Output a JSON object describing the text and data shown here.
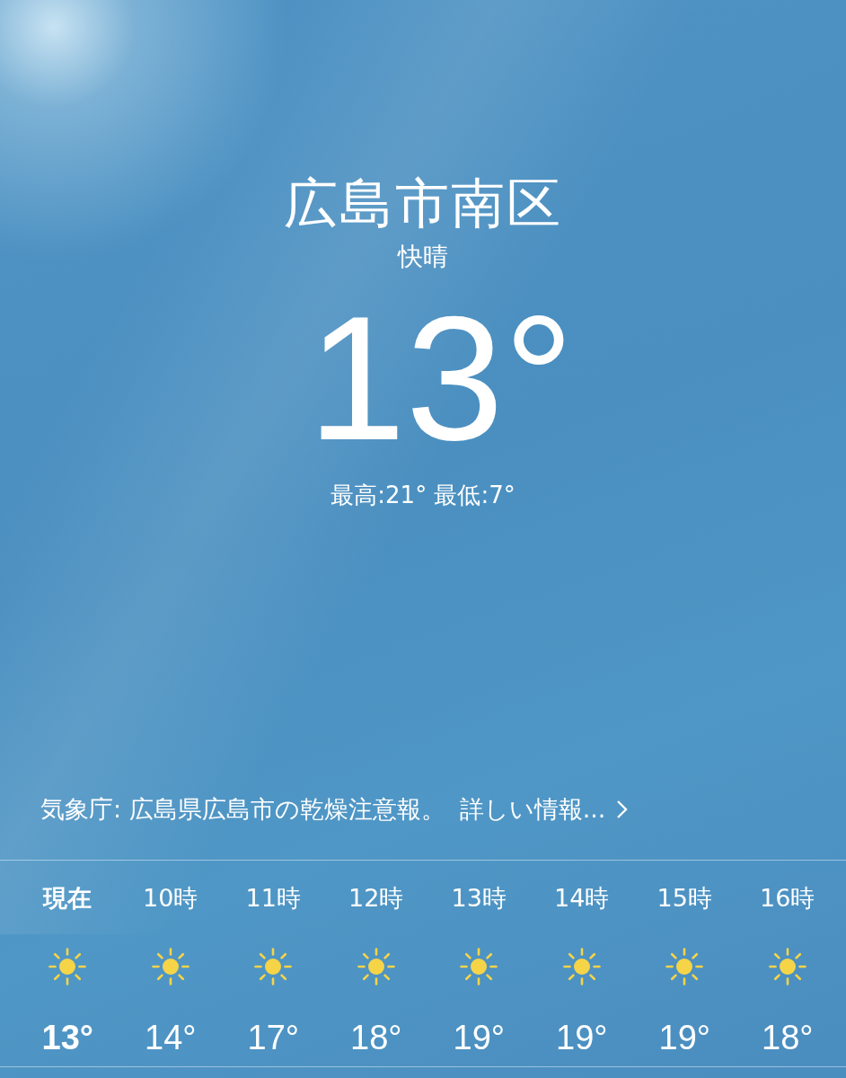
{
  "location": "広島市南区",
  "condition": "快晴",
  "temperature": "13°",
  "high_low": "最高:21° 最低:7°",
  "alert": {
    "text": "気象庁: 広島県広島市の乾燥注意報。",
    "link": "詳しい情報..."
  },
  "hourly": [
    {
      "time": "現在",
      "current": true,
      "kind": "sunny",
      "temperature": "13°"
    },
    {
      "time": "10時",
      "current": false,
      "kind": "sunny",
      "temperature": "14°"
    },
    {
      "time": "11時",
      "current": false,
      "kind": "sunny",
      "temperature": "17°"
    },
    {
      "time": "12時",
      "current": false,
      "kind": "sunny",
      "temperature": "18°"
    },
    {
      "time": "13時",
      "current": false,
      "kind": "sunny",
      "temperature": "19°"
    },
    {
      "time": "14時",
      "current": false,
      "kind": "sunny",
      "temperature": "19°"
    },
    {
      "time": "15時",
      "current": false,
      "kind": "sunny",
      "temperature": "19°"
    },
    {
      "time": "16時",
      "current": false,
      "kind": "sunny",
      "temperature": "18°"
    }
  ]
}
